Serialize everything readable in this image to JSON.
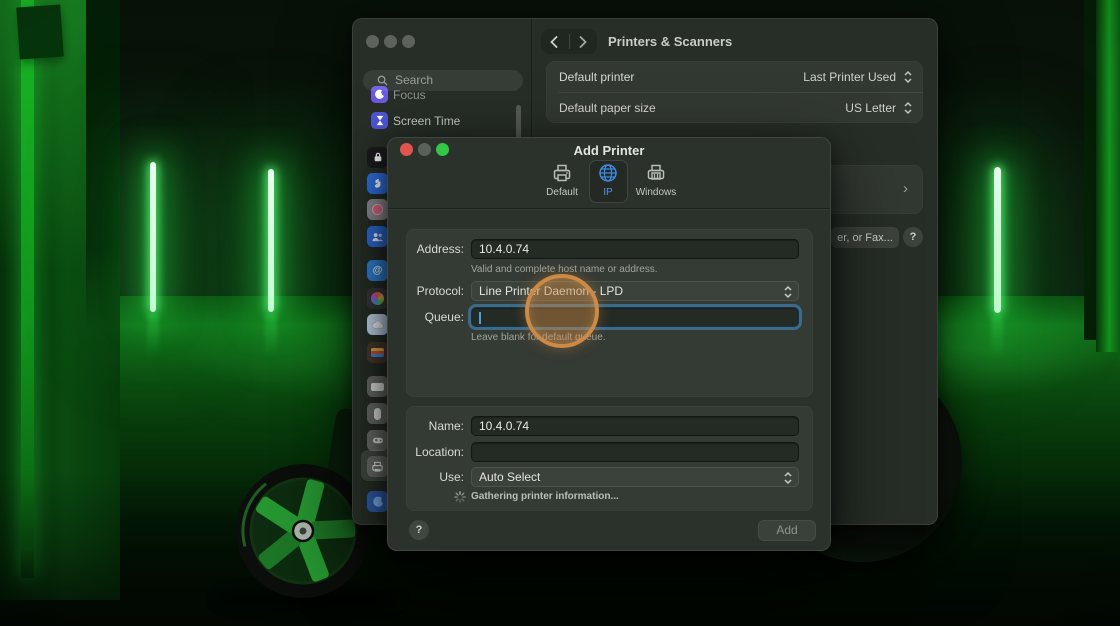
{
  "settings_window": {
    "header": {
      "title": "Printers & Scanners",
      "back_glyph": "‹",
      "forward_glyph": "›"
    },
    "sidebar": {
      "search": {
        "placeholder": "Search"
      },
      "items": [
        {
          "label": "Focus"
        },
        {
          "label": "Screen Time"
        }
      ],
      "mini_icons": [
        "lock-screen-icon",
        "accessibility-hand-icon",
        "touch-id-icon",
        "users-groups-icon",
        "internet-accounts-icon",
        "game-center-icon",
        "icloud-icon",
        "wallet-icon",
        "keyboard-icon",
        "mouse-icon",
        "game-controller-icon",
        "printers-scanners-icon",
        "family-icon"
      ]
    },
    "rows": [
      {
        "label": "Default printer",
        "value": "Last Printer Used"
      },
      {
        "label": "Default paper size",
        "value": "US Letter"
      }
    ],
    "printer_list_chevron": "›",
    "add_printer_button_visible_text": "er, or Fax...",
    "help_button": "?"
  },
  "dialog": {
    "title": "Add Printer",
    "tabs": [
      {
        "label": "Default",
        "selected": false
      },
      {
        "label": "IP",
        "selected": true
      },
      {
        "label": "Windows",
        "selected": false
      }
    ],
    "fields": {
      "address": {
        "label": "Address:",
        "value": "10.4.0.74",
        "helper": "Valid and complete host name or address."
      },
      "protocol": {
        "label": "Protocol:",
        "value": "Line Printer Daemon - LPD"
      },
      "queue": {
        "label": "Queue:",
        "value": "",
        "helper": "Leave blank for default queue."
      },
      "name": {
        "label": "Name:",
        "value": "10.4.0.74"
      },
      "location": {
        "label": "Location:",
        "value": ""
      },
      "use": {
        "label": "Use:",
        "value": "Auto Select"
      }
    },
    "status": "Gathering printer information...",
    "help_button": "?",
    "add_button": "Add"
  },
  "colors": {
    "neon_green": "#2eff55",
    "accent_blue": "#3f8ce8",
    "focus_ring": "#3f7396",
    "highlight_orange": "#cd8a45",
    "traffic_red": "#e0544e",
    "traffic_green": "#33c748",
    "window_bg": "#272e27",
    "dialog_bg": "#2b322b"
  }
}
